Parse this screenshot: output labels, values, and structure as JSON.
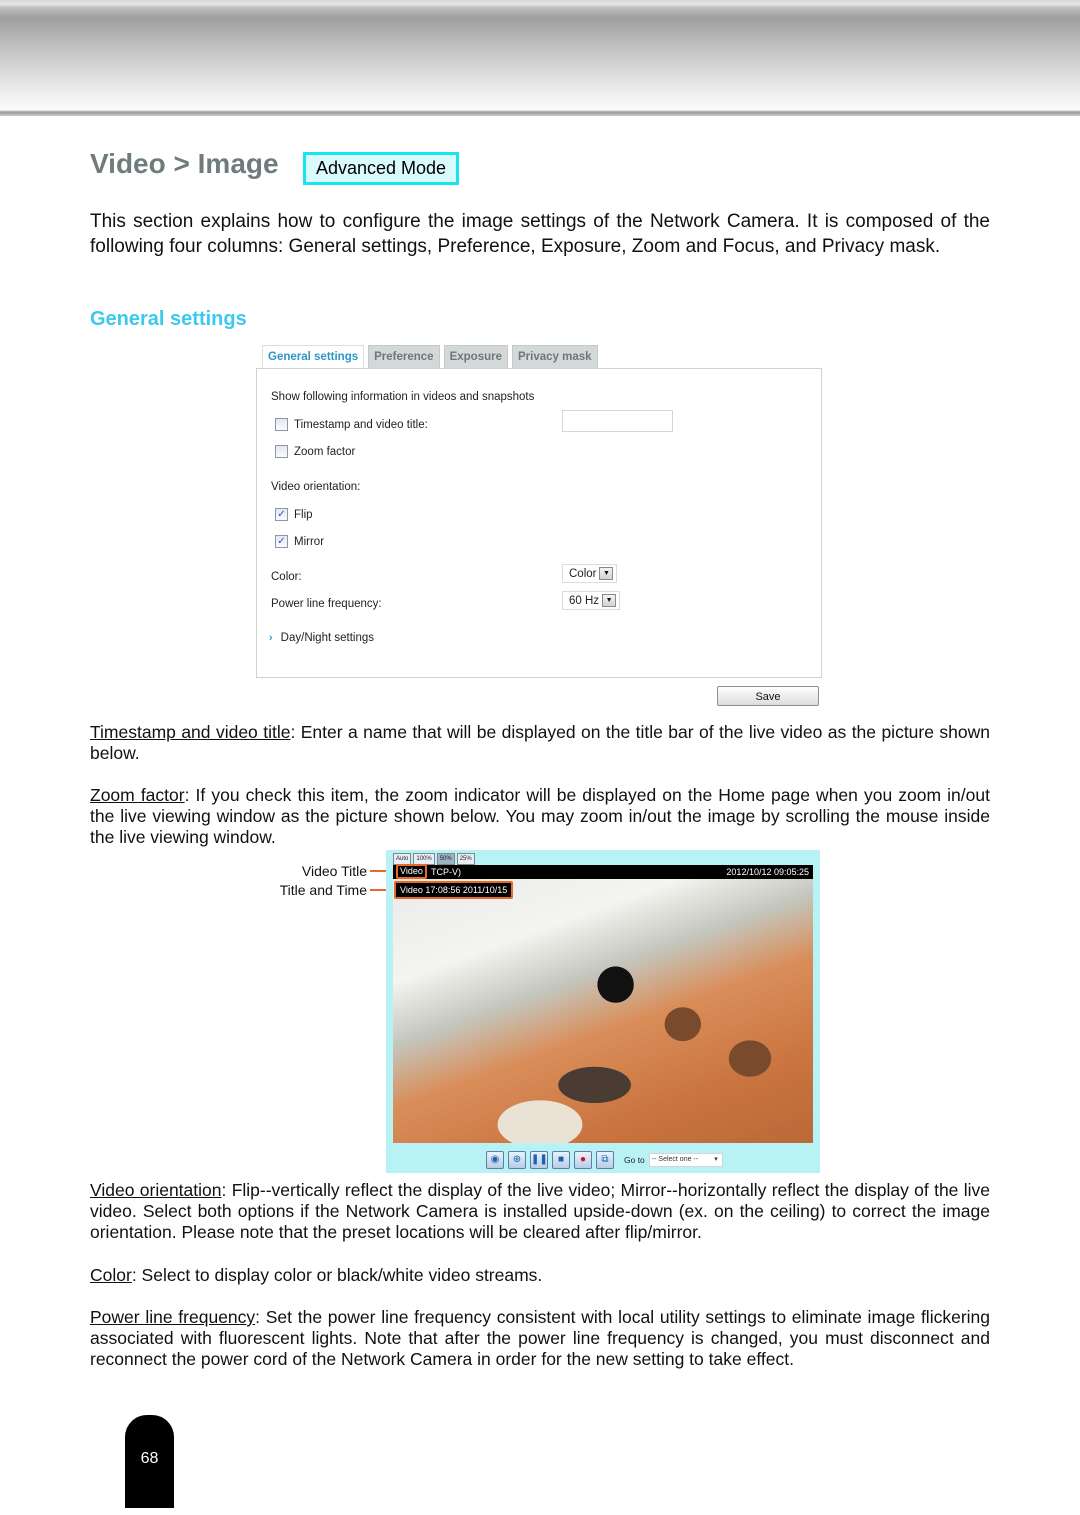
{
  "header": {
    "title": "Video > Image",
    "mode_badge": "Advanced Mode"
  },
  "intro": "This section explains how to configure the image settings of the Network Camera. It is composed of the following four columns: General settings, Preference, Exposure, Zoom and Focus, and Privacy mask.",
  "section_heading": "General settings",
  "settings_panel": {
    "tabs": [
      {
        "label": "General settings",
        "active": true
      },
      {
        "label": "Preference",
        "active": false
      },
      {
        "label": "Exposure",
        "active": false
      },
      {
        "label": "Privacy mask",
        "active": false
      }
    ],
    "show_info_label": "Show following information in videos and snapshots",
    "timestamp_label": "Timestamp and video title:",
    "timestamp_checked": false,
    "timestamp_value": "",
    "zoom_factor_label": "Zoom factor",
    "zoom_factor_checked": false,
    "orientation_label": "Video orientation:",
    "flip_label": "Flip",
    "flip_checked": true,
    "mirror_label": "Mirror",
    "mirror_checked": true,
    "color_label": "Color:",
    "color_value": "Color",
    "powerline_label": "Power line frequency:",
    "powerline_value": "60 Hz",
    "daynight_label": "Day/Night settings",
    "save_label": "Save"
  },
  "descriptions": {
    "timestamp": {
      "term": "Timestamp and video title",
      "text": ": Enter a name that will be displayed on the title bar of the live video as the picture shown below."
    },
    "zoom": {
      "term": "Zoom factor",
      "text": ": If you check this item, the zoom indicator will be displayed on the Home page when you zoom in/out the live viewing window as the picture shown below. You may zoom in/out the image by scrolling the mouse inside the live viewing window."
    },
    "orientation": {
      "term": "Video orientation",
      "text": ": Flip--vertically reflect the display of the live video; Mirror--horizontally reflect the display of the live video. Select both options if the Network Camera is installed upside-down (ex. on the ceiling) to correct the image orientation. Please note that the preset locations will be cleared after flip/mirror."
    },
    "color": {
      "term": "Color",
      "text": ": Select to display color or black/white video streams."
    },
    "powerline": {
      "term": "Power line frequency",
      "text": ": Set the power line frequency consistent with local utility settings to eliminate image flickering associated with fluorescent lights. Note that after the power line frequency is changed, you must disconnect and reconnect the power cord of the Network Camera in order for the new setting to take effect."
    }
  },
  "live_view": {
    "callout_video_title": "Video Title",
    "callout_title_time": "Title and Time",
    "zoom_buttons": [
      "Auto",
      "100%",
      "50%",
      "25%"
    ],
    "video_title": "Video",
    "protocol": "TCP-V)",
    "datetime": "2012/10/12  09:05:25",
    "title_time_overlay": "Video 17:08:56  2011/10/15",
    "goto_label": "Go to",
    "goto_select": "-- Select one --"
  },
  "page_number": "68"
}
